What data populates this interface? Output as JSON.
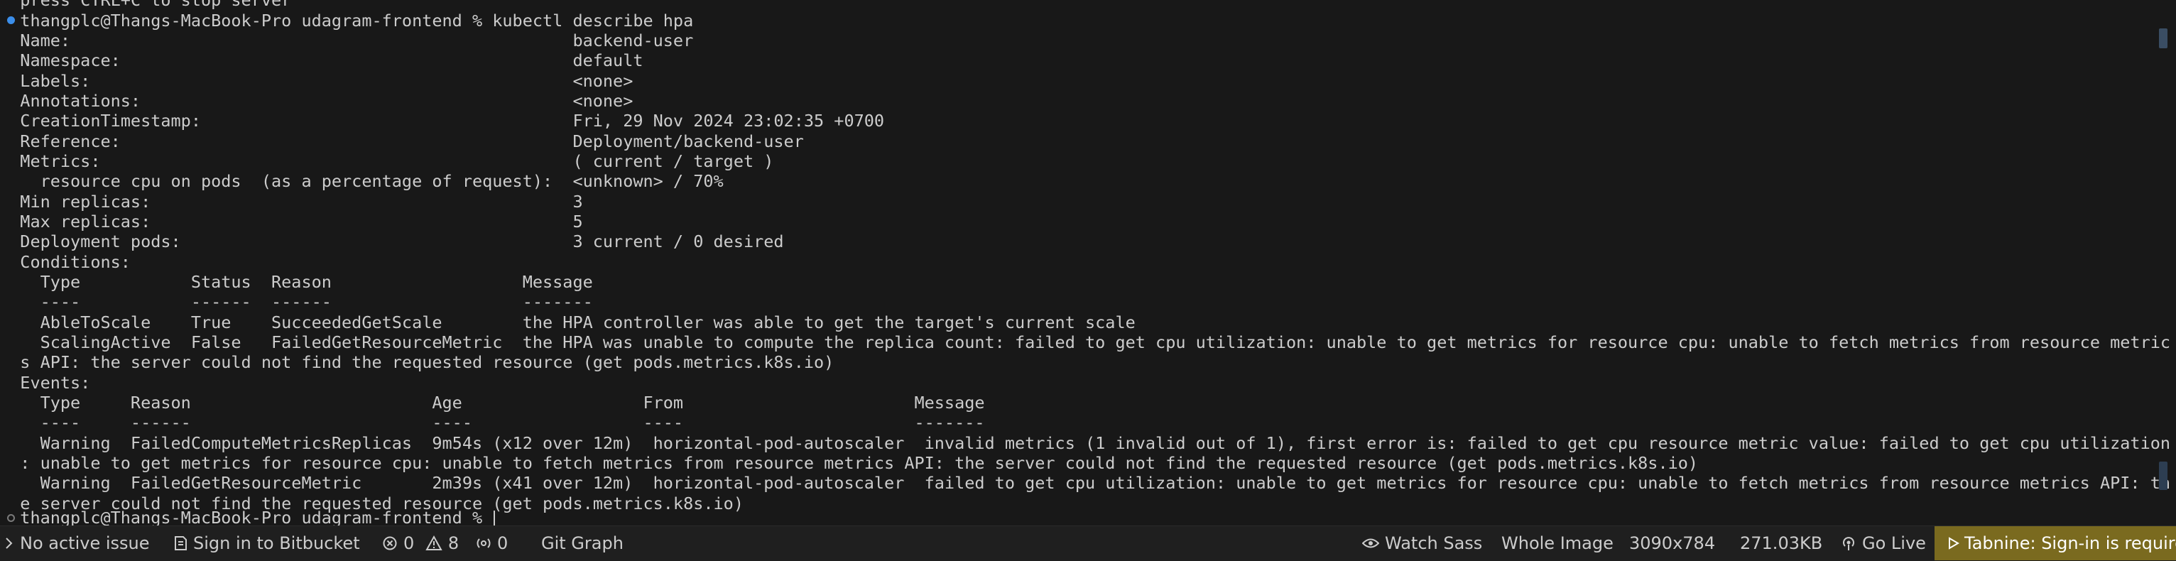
{
  "terminal": {
    "lines": [
      "  press CTRL+C to stop server",
      "  thangplc@Thangs-MacBook-Pro udagram-frontend % kubectl describe hpa",
      "  Name:                                                  backend-user",
      "  Namespace:                                             default",
      "  Labels:                                                <none>",
      "  Annotations:                                           <none>",
      "  CreationTimestamp:                                     Fri, 29 Nov 2024 23:02:35 +0700",
      "  Reference:                                             Deployment/backend-user",
      "  Metrics:                                               ( current / target )",
      "    resource cpu on pods  (as a percentage of request):  <unknown> / 70%",
      "  Min replicas:                                          3",
      "  Max replicas:                                          5",
      "  Deployment pods:                                       3 current / 0 desired",
      "  Conditions:",
      "    Type           Status  Reason                   Message",
      "    ----           ------  ------                   -------",
      "    AbleToScale    True    SucceededGetScale        the HPA controller was able to get the target's current scale",
      "    ScalingActive  False   FailedGetResourceMetric  the HPA was unable to compute the replica count: failed to get cpu utilization: unable to get metrics for resource cpu: unable to fetch metrics from resource metric",
      "  s API: the server could not find the requested resource (get pods.metrics.k8s.io)",
      "  Events:",
      "    Type     Reason                        Age                  From                       Message",
      "    ----     ------                        ----                 ----                       -------",
      "    Warning  FailedComputeMetricsReplicas  9m54s (x12 over 12m)  horizontal-pod-autoscaler  invalid metrics (1 invalid out of 1), first error is: failed to get cpu resource metric value: failed to get cpu utilization",
      "  : unable to get metrics for resource cpu: unable to fetch metrics from resource metrics API: the server could not find the requested resource (get pods.metrics.k8s.io)",
      "    Warning  FailedGetResourceMetric       2m39s (x41 over 12m)  horizontal-pod-autoscaler  failed to get cpu utilization: unable to get metrics for resource cpu: unable to fetch metrics from resource metrics API: th",
      "  e server could not find the requested resource (get pods.metrics.k8s.io)",
      "  thangplc@Thangs-MacBook-Pro udagram-frontend % "
    ]
  },
  "statusbar": {
    "issue": "No active issue",
    "bitbucket": "Sign in to Bitbucket",
    "errors": "0",
    "warnings": "8",
    "ports": "0",
    "git_graph": "Git Graph",
    "watch_sass": "Watch Sass",
    "whole_image": "Whole Image",
    "dimensions": "3090x784",
    "file_size": "271.03KB",
    "go_live": "Go Live",
    "tabnine": "Tabnine: Sign-in is require"
  },
  "colors": {
    "terminal_bg": "#181818",
    "statusbar_bg": "#1f1f1f",
    "tabnine_bg": "#7a6a1f",
    "prompt_dot": "#3b8eea"
  },
  "icons": [
    "chevron-right-icon",
    "bitbucket-icon",
    "error-icon",
    "warning-icon",
    "ports-icon",
    "broadcast-icon",
    "eye-icon",
    "tabnine-icon"
  ]
}
